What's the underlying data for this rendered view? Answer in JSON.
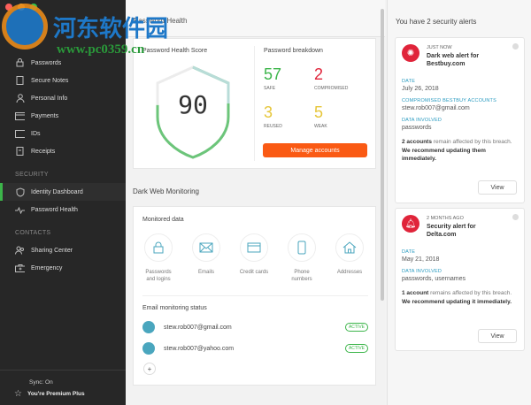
{
  "watermark": {
    "title": "河东软件园",
    "url": "www.pc0359.cn"
  },
  "sidebar": {
    "items": [
      {
        "label": "Passwords",
        "icon": "lock-icon"
      },
      {
        "label": "Secure Notes",
        "icon": "note-icon"
      },
      {
        "label": "Personal Info",
        "icon": "person-icon"
      },
      {
        "label": "Payments",
        "icon": "card-icon"
      },
      {
        "label": "IDs",
        "icon": "id-icon"
      },
      {
        "label": "Receipts",
        "icon": "receipt-icon"
      }
    ],
    "security_heading": "SECURITY",
    "security_items": [
      {
        "label": "Identity Dashboard",
        "icon": "shield-icon"
      },
      {
        "label": "Password Health",
        "icon": "pulse-icon"
      }
    ],
    "contacts_heading": "CONTACTS",
    "contacts_items": [
      {
        "label": "Sharing Center",
        "icon": "people-icon"
      },
      {
        "label": "Emergency",
        "icon": "briefcase-icon"
      }
    ],
    "sync": "Sync: On",
    "plan": "You're Premium Plus"
  },
  "main": {
    "title": "Password Health",
    "score_label": "Password Health Score",
    "score": "90",
    "score_fraction": 0.9,
    "breakdown_title": "Password breakdown",
    "breakdown": [
      {
        "value": "57",
        "label": "SAFE",
        "color": "#3cb54a"
      },
      {
        "value": "2",
        "label": "COMPROMISED",
        "color": "#e0243a"
      },
      {
        "value": "3",
        "label": "REUSED",
        "color": "#e6c63a"
      },
      {
        "value": "5",
        "label": "WEAK",
        "color": "#e6c63a"
      }
    ],
    "manage_button": "Manage accounts",
    "dwm_title": "Dark Web Monitoring",
    "monitored_title": "Monitored data",
    "monitored": [
      {
        "label": "Passwords and logins"
      },
      {
        "label": "Emails"
      },
      {
        "label": "Credit cards"
      },
      {
        "label": "Phone numbers"
      },
      {
        "label": "Addresses"
      }
    ],
    "email_status_title": "Email monitoring status",
    "emails": [
      {
        "email": "stew.rob007@gmail.com",
        "status": "ACTIVE"
      },
      {
        "email": "stew.rob007@yahoo.com",
        "status": "ACTIVE"
      }
    ],
    "add_label": "+"
  },
  "alerts": {
    "title": "You have 2 security alerts",
    "items": [
      {
        "time": "JUST NOW",
        "title": "Dark web alert for Bestbuy.com",
        "date_label": "DATE",
        "date": "July 26, 2018",
        "accounts_label": "COMPROMISED BESTBUY ACCOUNTS",
        "accounts": "stew.rob007@gmail.com",
        "data_label": "DATA INVOLVED",
        "data": "passwords",
        "count": "2 accounts",
        "msg": " remain affected by this breach. ",
        "rec": "We recommend updating them immediately.",
        "view": "View"
      },
      {
        "time": "2 MONTHS AGO",
        "title": "Security alert for Delta.com",
        "date_label": "DATE",
        "date": "May 21, 2018",
        "data_label": "DATA INVOLVED",
        "data": "passwords, usernames",
        "count": "1 account",
        "msg": " remains affected by this breach. ",
        "rec": "We recommend updating it immediately.",
        "view": "View"
      }
    ]
  }
}
